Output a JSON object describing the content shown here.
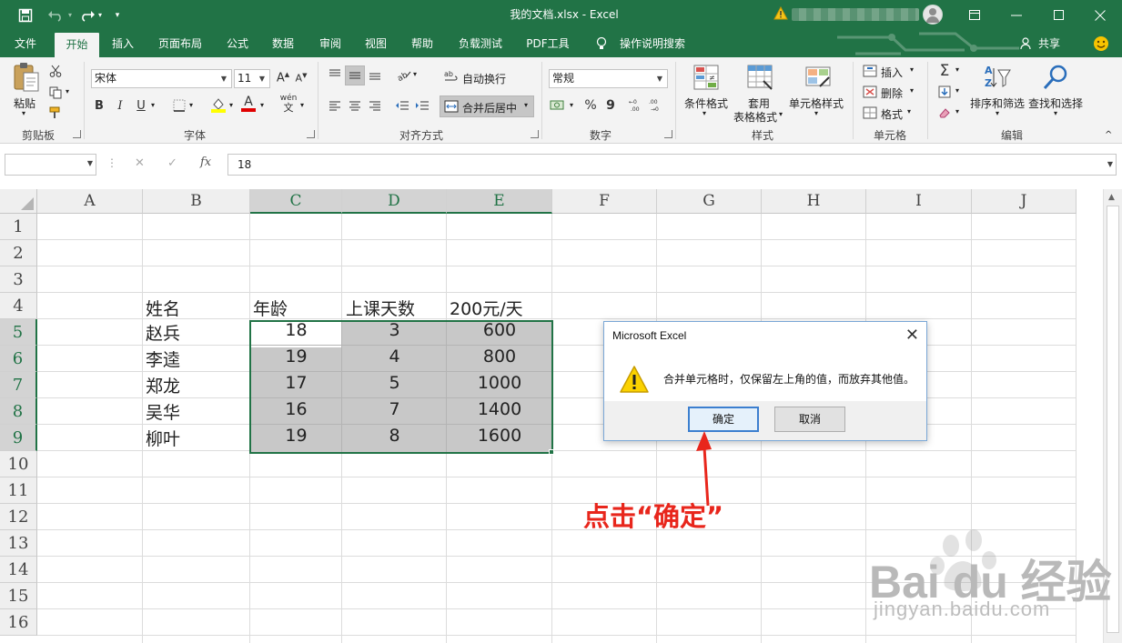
{
  "window": {
    "title": "我的文档.xlsx  -  Excel",
    "share_label": "共享",
    "icons": [
      "save-icon",
      "undo-icon",
      "redo-icon",
      "customize-icon",
      "warning-icon",
      "user-icon",
      "ribbon-display-icon",
      "minimize-icon",
      "maximize-icon",
      "close-icon"
    ]
  },
  "tabs": [
    "文件",
    "开始",
    "插入",
    "页面布局",
    "公式",
    "数据",
    "审阅",
    "视图",
    "帮助",
    "负载测试",
    "PDF工具",
    "操作说明搜索"
  ],
  "active_tab": "开始",
  "ribbon": {
    "clipboard": {
      "label": "剪贴板",
      "paste": "粘贴"
    },
    "font": {
      "label": "字体",
      "font_name": "宋体",
      "font_size": "11",
      "bold": "B",
      "italic": "I",
      "underline": "U",
      "font_color_letter": "A",
      "wen_label": "wén",
      "wen_char": "文"
    },
    "alignment": {
      "label": "对齐方式",
      "wrap": "自动换行",
      "merge": "合并后居中"
    },
    "number": {
      "label": "数字",
      "format": "常规",
      "percent": "%",
      "comma": "9"
    },
    "styles": {
      "label": "样式",
      "conditional": "条件格式",
      "table_line1": "套用",
      "table_line2": "表格格式",
      "cell_styles": "单元格样式"
    },
    "cells": {
      "label": "单元格",
      "insert": "插入",
      "delete": "删除",
      "format": "格式"
    },
    "editing": {
      "label": "编辑",
      "sort": "排序和筛选",
      "find": "查找和选择"
    },
    "accent_color": "#217346"
  },
  "formula_bar": {
    "name_box": "",
    "formula": "18",
    "fx": "fx"
  },
  "columns": [
    "A",
    "B",
    "C",
    "D",
    "E",
    "F",
    "G",
    "H",
    "I",
    "J"
  ],
  "selected_columns": [
    "C",
    "D",
    "E"
  ],
  "rows": [
    "1",
    "2",
    "3",
    "4",
    "5",
    "6",
    "7",
    "8",
    "9",
    "10",
    "11",
    "12",
    "13",
    "14",
    "15",
    "16"
  ],
  "selected_rows": [
    "5",
    "6",
    "7",
    "8",
    "9"
  ],
  "sheet": {
    "headers": {
      "B4": "姓名",
      "C4": "年龄",
      "D4": "上课天数",
      "E4": "200元/天"
    },
    "names": [
      "赵兵",
      "李逵",
      "郑龙",
      "吴华",
      "柳叶"
    ],
    "age": [
      "18",
      "19",
      "17",
      "16",
      "19"
    ],
    "days": [
      "3",
      "4",
      "5",
      "7",
      "8"
    ],
    "amount": [
      "600",
      "800",
      "1000",
      "1400",
      "1600"
    ]
  },
  "dialog": {
    "title": "Microsoft Excel",
    "message": "合并单元格时，仅保留左上角的值，而放弃其他值。",
    "ok": "确定",
    "cancel": "取消"
  },
  "annotation": {
    "text": "点击“确定”",
    "color": "#e8261c"
  },
  "watermark": {
    "brand": "Bai du 经验",
    "url": "jingyan.baidu.com"
  }
}
